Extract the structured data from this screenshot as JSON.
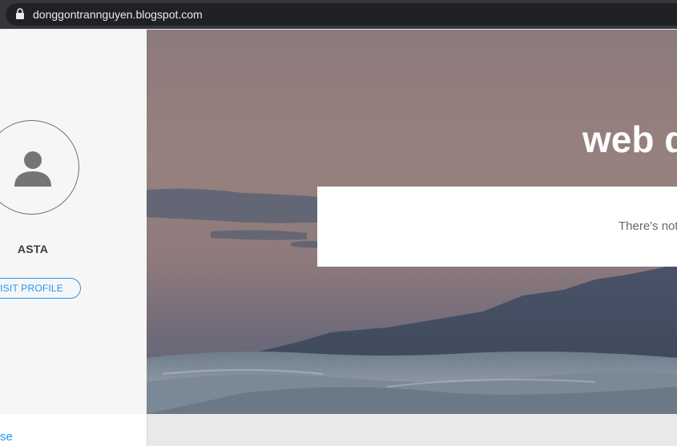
{
  "browser": {
    "url": "donggontrannguyen.blogspot.com",
    "lock_icon": "lock-icon"
  },
  "sidebar": {
    "avatar_icon": "person-icon",
    "profile_name": "ASTA",
    "visit_profile_label": "VISIT PROFILE",
    "bottom_link_fragment": "se"
  },
  "hero": {
    "title": "web d",
    "notice": "There's not"
  },
  "colors": {
    "accent": "#2196f3",
    "sidebar_bg": "#f6f6f6",
    "address_bar_bg": "#35363a"
  }
}
